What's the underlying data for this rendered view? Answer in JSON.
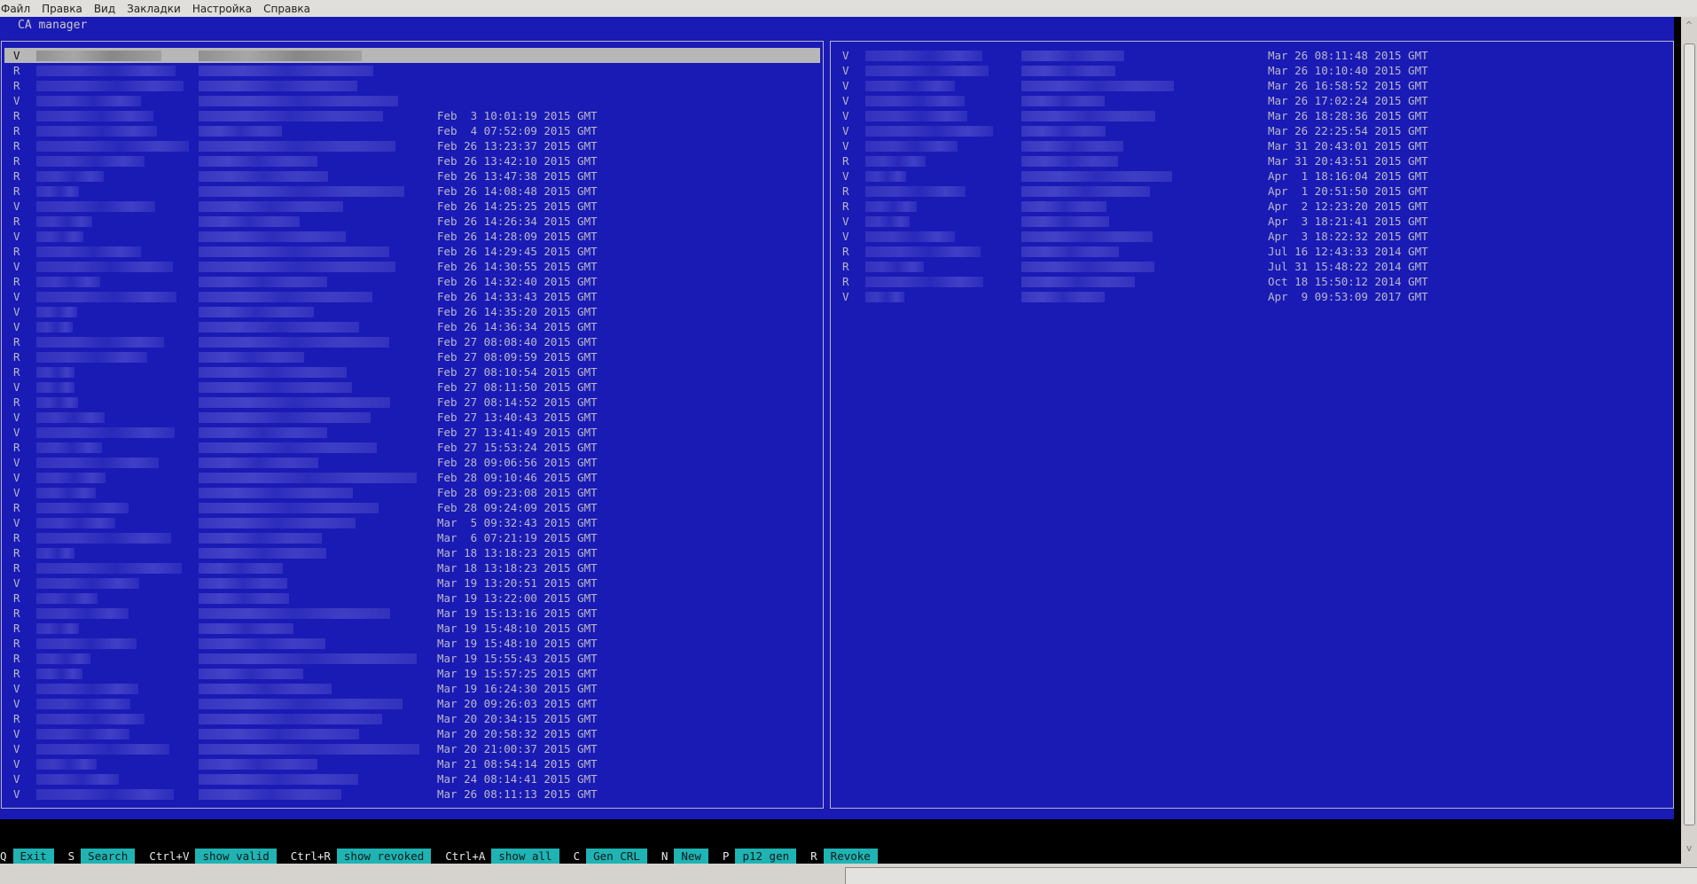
{
  "menu": [
    "Файл",
    "Правка",
    "Вид",
    "Закладки",
    "Настройка",
    "Справка"
  ],
  "app_title": "CA manager",
  "colors": {
    "terminal_blue": "#1a1ab5",
    "text": "#b9b9c9",
    "selection": "#b7b7b7",
    "key_label_bg": "#1fb3b3"
  },
  "left_panel": {
    "selected_index": 0,
    "rows": [
      {
        "status": "V",
        "date": ""
      },
      {
        "status": "R",
        "date": ""
      },
      {
        "status": "R",
        "date": ""
      },
      {
        "status": "V",
        "date": ""
      },
      {
        "status": "R",
        "date": "Feb  3 10:01:19 2015 GMT"
      },
      {
        "status": "R",
        "date": "Feb  4 07:52:09 2015 GMT"
      },
      {
        "status": "R",
        "date": "Feb 26 13:23:37 2015 GMT"
      },
      {
        "status": "R",
        "date": "Feb 26 13:42:10 2015 GMT"
      },
      {
        "status": "R",
        "date": "Feb 26 13:47:38 2015 GMT"
      },
      {
        "status": "R",
        "date": "Feb 26 14:08:48 2015 GMT"
      },
      {
        "status": "V",
        "date": "Feb 26 14:25:25 2015 GMT"
      },
      {
        "status": "R",
        "date": "Feb 26 14:26:34 2015 GMT"
      },
      {
        "status": "V",
        "date": "Feb 26 14:28:09 2015 GMT"
      },
      {
        "status": "R",
        "date": "Feb 26 14:29:45 2015 GMT"
      },
      {
        "status": "V",
        "date": "Feb 26 14:30:55 2015 GMT"
      },
      {
        "status": "R",
        "date": "Feb 26 14:32:40 2015 GMT"
      },
      {
        "status": "V",
        "date": "Feb 26 14:33:43 2015 GMT"
      },
      {
        "status": "V",
        "date": "Feb 26 14:35:20 2015 GMT"
      },
      {
        "status": "V",
        "date": "Feb 26 14:36:34 2015 GMT"
      },
      {
        "status": "R",
        "date": "Feb 27 08:08:40 2015 GMT"
      },
      {
        "status": "R",
        "date": "Feb 27 08:09:59 2015 GMT"
      },
      {
        "status": "R",
        "date": "Feb 27 08:10:54 2015 GMT"
      },
      {
        "status": "V",
        "date": "Feb 27 08:11:50 2015 GMT"
      },
      {
        "status": "R",
        "date": "Feb 27 08:14:52 2015 GMT"
      },
      {
        "status": "V",
        "date": "Feb 27 13:40:43 2015 GMT"
      },
      {
        "status": "V",
        "date": "Feb 27 13:41:49 2015 GMT"
      },
      {
        "status": "R",
        "date": "Feb 27 15:53:24 2015 GMT"
      },
      {
        "status": "V",
        "date": "Feb 28 09:06:56 2015 GMT"
      },
      {
        "status": "V",
        "date": "Feb 28 09:10:46 2015 GMT"
      },
      {
        "status": "V",
        "date": "Feb 28 09:23:08 2015 GMT"
      },
      {
        "status": "R",
        "date": "Feb 28 09:24:09 2015 GMT"
      },
      {
        "status": "V",
        "date": "Mar  5 09:32:43 2015 GMT"
      },
      {
        "status": "R",
        "date": "Mar  6 07:21:19 2015 GMT"
      },
      {
        "status": "R",
        "date": "Mar 18 13:18:23 2015 GMT"
      },
      {
        "status": "R",
        "date": "Mar 18 13:18:23 2015 GMT"
      },
      {
        "status": "V",
        "date": "Mar 19 13:20:51 2015 GMT"
      },
      {
        "status": "R",
        "date": "Mar 19 13:22:00 2015 GMT"
      },
      {
        "status": "R",
        "date": "Mar 19 15:13:16 2015 GMT"
      },
      {
        "status": "R",
        "date": "Mar 19 15:48:10 2015 GMT"
      },
      {
        "status": "R",
        "date": "Mar 19 15:48:10 2015 GMT"
      },
      {
        "status": "R",
        "date": "Mar 19 15:55:43 2015 GMT"
      },
      {
        "status": "R",
        "date": "Mar 19 15:57:25 2015 GMT"
      },
      {
        "status": "V",
        "date": "Mar 19 16:24:30 2015 GMT"
      },
      {
        "status": "V",
        "date": "Mar 20 09:26:03 2015 GMT"
      },
      {
        "status": "R",
        "date": "Mar 20 20:34:15 2015 GMT"
      },
      {
        "status": "V",
        "date": "Mar 20 20:58:32 2015 GMT"
      },
      {
        "status": "V",
        "date": "Mar 20 21:00:37 2015 GMT"
      },
      {
        "status": "V",
        "date": "Mar 21 08:54:14 2015 GMT"
      },
      {
        "status": "V",
        "date": "Mar 24 08:14:41 2015 GMT"
      },
      {
        "status": "V",
        "date": "Mar 26 08:11:13 2015 GMT"
      }
    ]
  },
  "right_panel": {
    "rows": [
      {
        "status": "V",
        "date": "Mar 26 08:11:48 2015 GMT"
      },
      {
        "status": "V",
        "date": "Mar 26 10:10:40 2015 GMT"
      },
      {
        "status": "V",
        "date": "Mar 26 16:58:52 2015 GMT"
      },
      {
        "status": "V",
        "date": "Mar 26 17:02:24 2015 GMT"
      },
      {
        "status": "V",
        "date": "Mar 26 18:28:36 2015 GMT"
      },
      {
        "status": "V",
        "date": "Mar 26 22:25:54 2015 GMT"
      },
      {
        "status": "V",
        "date": "Mar 31 20:43:01 2015 GMT"
      },
      {
        "status": "R",
        "date": "Mar 31 20:43:51 2015 GMT"
      },
      {
        "status": "V",
        "date": "Apr  1 18:16:04 2015 GMT"
      },
      {
        "status": "R",
        "date": "Apr  1 20:51:50 2015 GMT"
      },
      {
        "status": "R",
        "date": "Apr  2 12:23:20 2015 GMT"
      },
      {
        "status": "V",
        "date": "Apr  3 18:21:41 2015 GMT"
      },
      {
        "status": "V",
        "date": "Apr  3 18:22:32 2015 GMT"
      },
      {
        "status": "R",
        "date": "Jul 16 12:43:33 2014 GMT"
      },
      {
        "status": "R",
        "date": "Jul 31 15:48:22 2014 GMT"
      },
      {
        "status": "R",
        "date": "Oct 18 15:50:12 2014 GMT"
      },
      {
        "status": "V",
        "date": "Apr  9 09:53:09 2017 GMT"
      }
    ]
  },
  "keybar": [
    {
      "key": "Q",
      "label": "Exit"
    },
    {
      "key": "S",
      "label": "Search"
    },
    {
      "key": "Ctrl+V",
      "label": "show valid"
    },
    {
      "key": "Ctrl+R",
      "label": "show revoked"
    },
    {
      "key": "Ctrl+A",
      "label": "show all"
    },
    {
      "key": "C",
      "label": "Gen CRL"
    },
    {
      "key": "N",
      "label": "New"
    },
    {
      "key": "P",
      "label": "p12 gen"
    },
    {
      "key": "R",
      "label": "Revoke"
    }
  ],
  "scrollbar": {
    "up_icon": "^",
    "down_icon": "v"
  }
}
